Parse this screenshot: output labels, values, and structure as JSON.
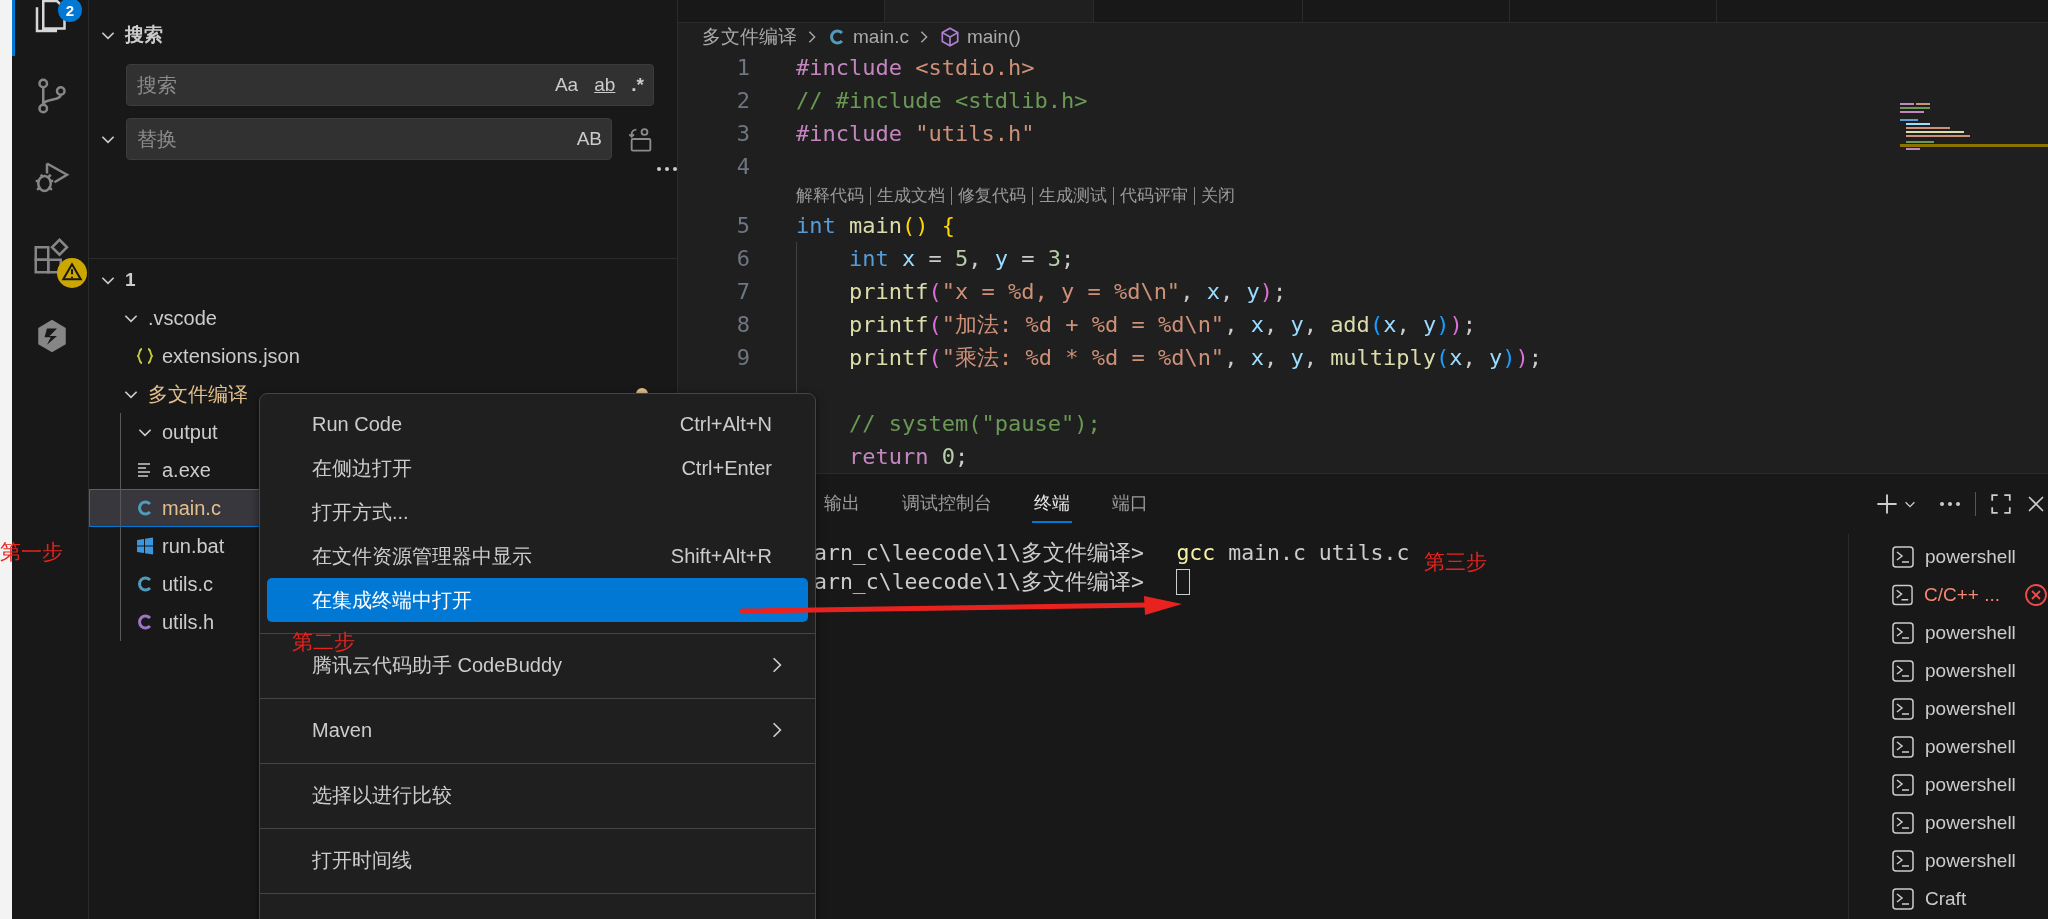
{
  "activity_bar": {
    "items": [
      {
        "kind": "explorer",
        "selected": true,
        "badge": "2",
        "warning": false
      },
      {
        "kind": "source_control",
        "selected": false,
        "warning": false
      },
      {
        "kind": "run_debug",
        "selected": false,
        "warning": false
      },
      {
        "kind": "extensions",
        "selected": false,
        "warning": true
      },
      {
        "kind": "codebuddy",
        "selected": false,
        "warning": false
      }
    ]
  },
  "search": {
    "title": "搜索",
    "expanded": true,
    "replace_expanded": true,
    "query": {
      "placeholder": "搜索",
      "options": [
        {
          "kind": "match_case",
          "text": "Aa"
        },
        {
          "kind": "whole_word",
          "text": "ab"
        },
        {
          "kind": "regex",
          "text": ".*"
        }
      ]
    },
    "replace": {
      "placeholder": "替换",
      "options": [
        {
          "kind": "preserve_case",
          "text": "AB"
        }
      ]
    }
  },
  "explorer": {
    "title": "1",
    "expanded": true,
    "tree": [
      {
        "name": ".vscode",
        "kind": "folder",
        "expanded": true,
        "selected": false,
        "modified": false,
        "children": [
          {
            "name": "extensions.json",
            "kind": "json",
            "selected": false,
            "modified": false
          }
        ]
      },
      {
        "name": "多文件编译",
        "kind": "folder",
        "expanded": true,
        "selected": false,
        "modified": true,
        "children": [
          {
            "name": "output",
            "kind": "folder",
            "expanded": true,
            "selected": false,
            "modified": false
          },
          {
            "name": "a.exe",
            "kind": "exe",
            "selected": false,
            "modified": false
          },
          {
            "name": "main.c",
            "kind": "c",
            "selected": true,
            "modified": true
          },
          {
            "name": "run.bat",
            "kind": "bat",
            "selected": false,
            "modified": false
          },
          {
            "name": "utils.c",
            "kind": "c",
            "selected": false,
            "modified": false
          },
          {
            "name": "utils.h",
            "kind": "h",
            "selected": false,
            "modified": false
          }
        ]
      }
    ]
  },
  "editor": {
    "breadcrumb": [
      {
        "text": "多文件编译",
        "kind": "folder"
      },
      {
        "text": "main.c",
        "kind": "c"
      },
      {
        "text": "main()",
        "kind": "function"
      }
    ],
    "lines": [
      {
        "kind": "code",
        "number": "1",
        "indented": false,
        "tokens": [
          {
            "t": "#include",
            "kind": "kw"
          },
          {
            "t": " <stdio.h>",
            "kind": "str"
          }
        ]
      },
      {
        "kind": "code",
        "number": "2",
        "indented": false,
        "tokens": [
          {
            "t": "// #include <stdlib.h>",
            "kind": "cmt"
          }
        ]
      },
      {
        "kind": "code",
        "number": "3",
        "indented": false,
        "tokens": [
          {
            "t": "#include",
            "kind": "kw"
          },
          {
            "t": " \"utils.h\"",
            "kind": "str"
          }
        ]
      },
      {
        "kind": "code",
        "number": "4"
      },
      {
        "kind": "codelens",
        "actions": [
          "解释代码",
          "生成文档",
          "修复代码",
          "生成测试",
          "代码评审",
          "关闭"
        ]
      },
      {
        "kind": "code",
        "number": "5",
        "indented": false,
        "tokens": [
          {
            "t": "int",
            "kind": "type"
          },
          {
            "t": " main",
            "kind": "fn"
          },
          {
            "t": "()",
            "kind": "b1"
          },
          {
            "t": " {",
            "kind": "b1"
          }
        ]
      },
      {
        "kind": "code",
        "number": "6",
        "indented": true,
        "tokens": [
          {
            "t": "int",
            "kind": "type"
          },
          {
            "t": " x",
            "kind": "var"
          },
          {
            "t": " = ",
            "kind": "p"
          },
          {
            "t": "5",
            "kind": "num"
          },
          {
            "t": ", ",
            "kind": "p"
          },
          {
            "t": "y",
            "kind": "var"
          },
          {
            "t": " = ",
            "kind": "p"
          },
          {
            "t": "3",
            "kind": "num"
          },
          {
            "t": ";",
            "kind": "p"
          }
        ]
      },
      {
        "kind": "code",
        "number": "7",
        "indented": true,
        "tokens": [
          {
            "t": "printf",
            "kind": "fn"
          },
          {
            "t": "(",
            "kind": "b2"
          },
          {
            "t": "\"x = %d, y = %d\\n\"",
            "kind": "str"
          },
          {
            "t": ", ",
            "kind": "p"
          },
          {
            "t": "x",
            "kind": "var"
          },
          {
            "t": ", ",
            "kind": "p"
          },
          {
            "t": "y",
            "kind": "var"
          },
          {
            "t": ")",
            "kind": "b2"
          },
          {
            "t": ";",
            "kind": "p"
          }
        ]
      },
      {
        "kind": "code",
        "number": "8",
        "indented": true,
        "tokens": [
          {
            "t": "printf",
            "kind": "fn"
          },
          {
            "t": "(",
            "kind": "b2"
          },
          {
            "t": "\"加法: %d + %d = %d\\n\"",
            "kind": "str"
          },
          {
            "t": ", ",
            "kind": "p"
          },
          {
            "t": "x",
            "kind": "var"
          },
          {
            "t": ", ",
            "kind": "p"
          },
          {
            "t": "y",
            "kind": "var"
          },
          {
            "t": ", ",
            "kind": "p"
          },
          {
            "t": "add",
            "kind": "fn"
          },
          {
            "t": "(",
            "kind": "b3"
          },
          {
            "t": "x",
            "kind": "var"
          },
          {
            "t": ", ",
            "kind": "p"
          },
          {
            "t": "y",
            "kind": "var"
          },
          {
            "t": ")",
            "kind": "b3"
          },
          {
            "t": ")",
            "kind": "b2"
          },
          {
            "t": ";",
            "kind": "p"
          }
        ]
      },
      {
        "kind": "code",
        "number": "9",
        "indented": true,
        "tokens": [
          {
            "t": "printf",
            "kind": "fn"
          },
          {
            "t": "(",
            "kind": "b2"
          },
          {
            "t": "\"乘法: %d * %d = %d\\n\"",
            "kind": "str"
          },
          {
            "t": ", ",
            "kind": "p"
          },
          {
            "t": "x",
            "kind": "var"
          },
          {
            "t": ", ",
            "kind": "p"
          },
          {
            "t": "y",
            "kind": "var"
          },
          {
            "t": ", ",
            "kind": "p"
          },
          {
            "t": "multiply",
            "kind": "fn"
          },
          {
            "t": "(",
            "kind": "b3"
          },
          {
            "t": "x",
            "kind": "var"
          },
          {
            "t": ", ",
            "kind": "p"
          },
          {
            "t": "y",
            "kind": "var"
          },
          {
            "t": ")",
            "kind": "b3"
          },
          {
            "t": ")",
            "kind": "b2"
          },
          {
            "t": ";",
            "kind": "p"
          }
        ]
      },
      {
        "kind": "code",
        "indented": true
      },
      {
        "kind": "code",
        "indented": true,
        "tokens": [
          {
            "t": "// system(\"pause\");",
            "kind": "cmt"
          }
        ]
      },
      {
        "kind": "code",
        "indented": true,
        "tokens": [
          {
            "t": "return",
            "kind": "kw"
          },
          {
            "t": " 0",
            "kind": "num"
          },
          {
            "t": ";",
            "kind": "p"
          }
        ]
      }
    ]
  },
  "panel": {
    "tabs": [
      {
        "label": "输出",
        "selected": false
      },
      {
        "label": "调试控制台",
        "selected": false
      },
      {
        "label": "终端",
        "selected": true
      },
      {
        "label": "端口",
        "selected": false
      }
    ],
    "terminal": {
      "lines": [
        {
          "prompt": "arn_c\\leecode\\1\\多文件编译>",
          "command": "gcc",
          "args": "main.c utils.c"
        },
        {
          "prompt": "arn_c\\leecode\\1\\多文件编译>",
          "cursor": true
        }
      ]
    },
    "terminal_list": [
      {
        "name": "powershell",
        "kind": "shell"
      },
      {
        "name": "C/C++ ...",
        "kind": "error"
      },
      {
        "name": "powershell",
        "kind": "shell"
      },
      {
        "name": "powershell",
        "kind": "shell"
      },
      {
        "name": "powershell",
        "kind": "shell"
      },
      {
        "name": "powershell",
        "kind": "shell"
      },
      {
        "name": "powershell",
        "kind": "shell"
      },
      {
        "name": "powershell",
        "kind": "shell"
      },
      {
        "name": "powershell",
        "kind": "shell"
      },
      {
        "name": "Craft",
        "kind": "shell"
      }
    ]
  },
  "context_menu": {
    "items": [
      {
        "kind": "item",
        "label": "Run Code",
        "shortcut": "Ctrl+Alt+N",
        "selected": false,
        "submenu": false
      },
      {
        "kind": "item",
        "label": "在侧边打开",
        "shortcut": "Ctrl+Enter",
        "selected": false,
        "submenu": false
      },
      {
        "kind": "item",
        "label": "打开方式...",
        "selected": false,
        "submenu": false
      },
      {
        "kind": "item",
        "label": "在文件资源管理器中显示",
        "shortcut": "Shift+Alt+R",
        "selected": false,
        "submenu": false
      },
      {
        "kind": "item",
        "label": "在集成终端中打开",
        "selected": true,
        "submenu": false
      },
      {
        "kind": "separator"
      },
      {
        "kind": "item",
        "label": "腾讯云代码助手 CodeBuddy",
        "selected": false,
        "submenu": true
      },
      {
        "kind": "separator"
      },
      {
        "kind": "item",
        "label": "Maven",
        "selected": false,
        "submenu": true
      },
      {
        "kind": "separator"
      },
      {
        "kind": "item",
        "label": "选择以进行比较",
        "selected": false,
        "submenu": false
      },
      {
        "kind": "separator"
      },
      {
        "kind": "item",
        "label": "打开时间线",
        "selected": false,
        "submenu": false
      },
      {
        "kind": "separator"
      }
    ]
  },
  "annotations": [
    {
      "text": "第一步"
    },
    {
      "text": "第二步"
    },
    {
      "text": "第三步"
    }
  ]
}
